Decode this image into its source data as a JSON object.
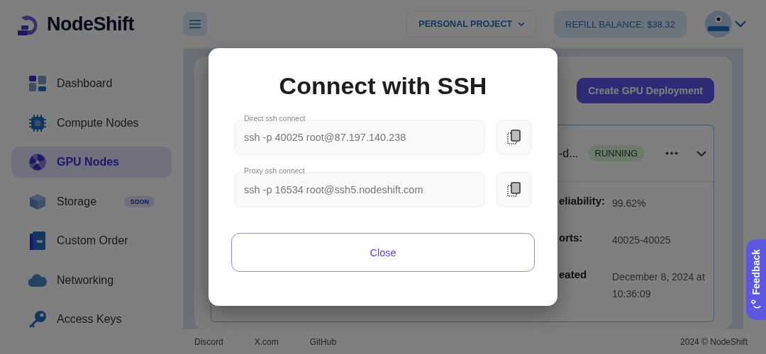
{
  "brand": {
    "name": "NodeShift"
  },
  "sidebar": {
    "items": [
      {
        "label": "Dashboard",
        "selected": false
      },
      {
        "label": "Compute Nodes",
        "selected": false
      },
      {
        "label": "GPU Nodes",
        "selected": true
      },
      {
        "label": "Storage",
        "selected": false,
        "badge": "SOON"
      },
      {
        "label": "Custom Order",
        "selected": false
      },
      {
        "label": "Networking",
        "selected": false
      },
      {
        "label": "Access Keys",
        "selected": false
      }
    ]
  },
  "header": {
    "project": "PERSONAL PROJECT",
    "balance_label": "REFILL BALANCE:",
    "balance": "$38.32"
  },
  "page": {
    "create_button": "Create GPU Deployment",
    "node": {
      "name": "-d...",
      "status": "RUNNING",
      "details": [
        {
          "label": "eliability:",
          "value": "99.62%"
        },
        {
          "label": "orts:",
          "value": "40025-40025"
        },
        {
          "label": "eated",
          "value": "December 8, 2024 at 10:36:09"
        }
      ]
    }
  },
  "footer": {
    "links": [
      "Discord",
      "X.com",
      "GitHub"
    ],
    "copyright": "2024 © NodeShift"
  },
  "modal": {
    "title": "Connect with SSH",
    "fields": [
      {
        "label": "Direct ssh connect",
        "value": "ssh -p 40025 root@87.197.140.238"
      },
      {
        "label": "Proxy ssh connect",
        "value": "ssh -p 16534 root@ssh5.nodeshift.com"
      }
    ],
    "close": "Close"
  },
  "feedback": {
    "label": "Feedback"
  }
}
